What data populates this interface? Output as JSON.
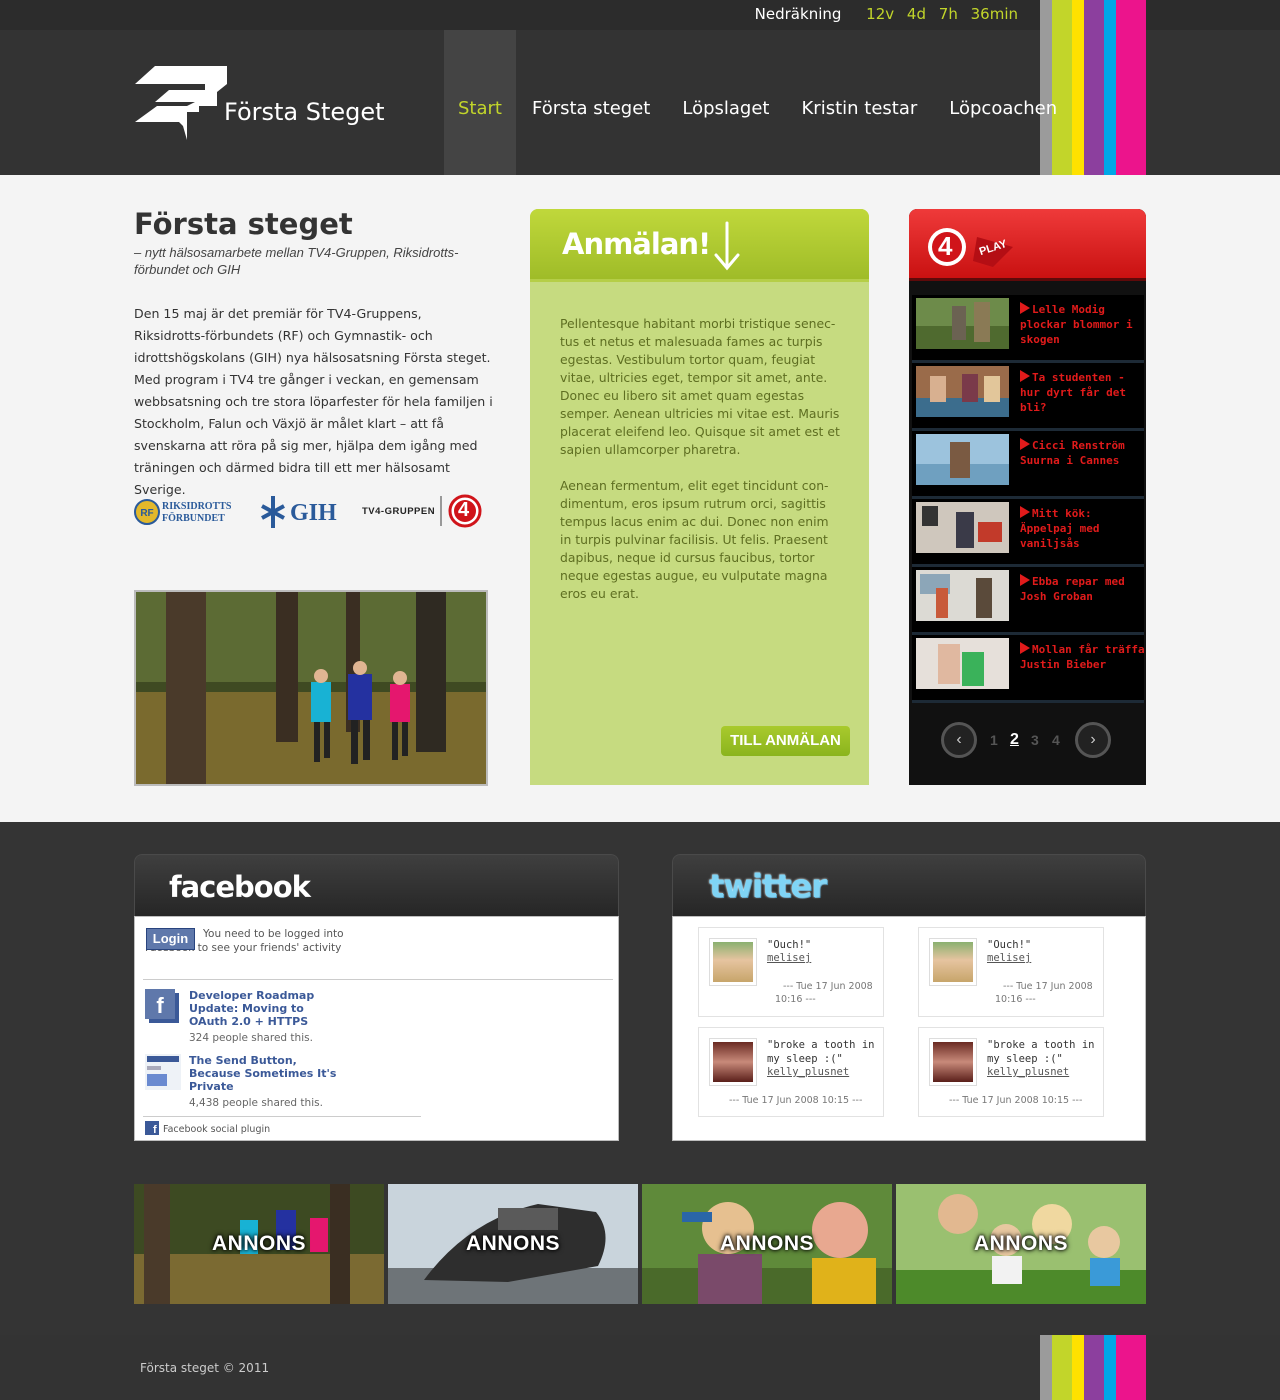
{
  "brand": {
    "name": "Första Steget",
    "stripe_colors": [
      "#9b9b9b",
      "#c2d52a",
      "#ffe100",
      "#8c3f9e",
      "#00a7e7",
      "#ec148c"
    ]
  },
  "countdown": {
    "label": "Nedräkning",
    "weeks": "12v",
    "days": "4d",
    "hours": "7h",
    "minutes": "36min"
  },
  "nav": {
    "items": [
      {
        "label": "Start"
      },
      {
        "label": "Första steget"
      },
      {
        "label": "Löpslaget"
      },
      {
        "label": "Kristin testar"
      },
      {
        "label": "Löpcoachen"
      }
    ]
  },
  "intro": {
    "title": "Första steget",
    "subtitle": "– nytt hälsosamarbete mellan TV4-Gruppen, Riksidrotts-förbundet och GIH",
    "body": "Den 15 maj är det premiär för TV4-Gruppens, Riksidrotts-förbundets (RF) och Gymnastik- och idrottshögskolans (GIH) nya hälsosatsning Första steget. Med program i TV4 tre gånger i veckan, en gemensam webbsatsning och tre stora löparfester för hela familjen i Stockholm, Falun och Växjö är målet klart – att få svenskarna att röra på sig mer, hjälpa dem igång med träningen och därmed bidra till ett mer hälsosamt Sverige."
  },
  "partners": {
    "rf_line1": "RIKSIDROTTS",
    "rf_line2": "FÖRBUNDET",
    "gih": "GIH",
    "tv4": "TV4-GRUPPEN",
    "tv4_num": "4"
  },
  "signup": {
    "title": "Anmälan!",
    "paragraph1": "Pellentesque habitant morbi tristique senec-tus et netus et malesuada fames ac turpis egestas. Vestibulum tortor quam, feugiat vitae, ultricies eget, tempor sit amet, ante. Donec eu libero sit amet quam egestas semper. Aenean ultricies mi vitae est. Mauris placerat eleifend leo. Quisque sit amet est et sapien ullamcorper pharetra.",
    "paragraph2": "Aenean fermentum, elit eget tincidunt con-dimentum, eros ipsum rutrum orci, sagittis tempus lacus enim ac dui. Donec non enim in turpis pulvinar facilisis. Ut felis. Praesent dapibus, neque id cursus faucibus, tortor neque egestas augue, eu vulputate magna eros eu erat.",
    "button": "TILL ANMÄLAN"
  },
  "tv4play": {
    "logo_num": "4",
    "logo_play": "PLAY",
    "videos": [
      {
        "title": "Lelle Modig plockar blommor i skogen"
      },
      {
        "title": "Ta studenten - hur dyrt får det bli?"
      },
      {
        "title": "Cicci Renström Suurna i Cannes"
      },
      {
        "title": "Mitt kök: Äppelpaj med vaniljsås"
      },
      {
        "title": "Ebba repar med Josh Groban"
      },
      {
        "title": "Mollan får träffa Justin Bieber"
      }
    ],
    "pager": {
      "prev": "‹",
      "next": "›",
      "pages": [
        "1",
        "2",
        "3",
        "4"
      ],
      "current": "2"
    }
  },
  "facebook": {
    "logo": "facebook",
    "login_button": "Login",
    "login_text": "You need to be logged into Facebook to see your friends' activity",
    "items": [
      {
        "title": "Developer Roadmap Update: Moving to OAuth 2.0 + HTTPS",
        "shares": "324 people shared this."
      },
      {
        "title": "The Send Button, Because Sometimes It's Private",
        "shares": "4,438 people shared this."
      }
    ],
    "plugin_label": "Facebook social plugin"
  },
  "twitter": {
    "logo": "twitter",
    "tweets": [
      {
        "text": "\"Ouch!\"",
        "user": "melisej",
        "date": "--- Tue 17 Jun 2008 10:16 ---"
      },
      {
        "text": "\"Ouch!\"",
        "user": "melisej",
        "date": "--- Tue 17 Jun 2008 10:16 ---"
      },
      {
        "text": "\"broke a tooth in my sleep :(\"",
        "user": "kelly_plusnet",
        "date": "--- Tue 17 Jun 2008 10:15 ---"
      },
      {
        "text": "\"broke a tooth in my sleep :(\"",
        "user": "kelly_plusnet",
        "date": "--- Tue 17 Jun 2008 10:15 ---"
      }
    ]
  },
  "ads": [
    {
      "label": "ANNONS"
    },
    {
      "label": "ANNONS"
    },
    {
      "label": "ANNONS"
    },
    {
      "label": "ANNONS"
    }
  ],
  "footer": {
    "copyright": "Första steget © 2011"
  }
}
